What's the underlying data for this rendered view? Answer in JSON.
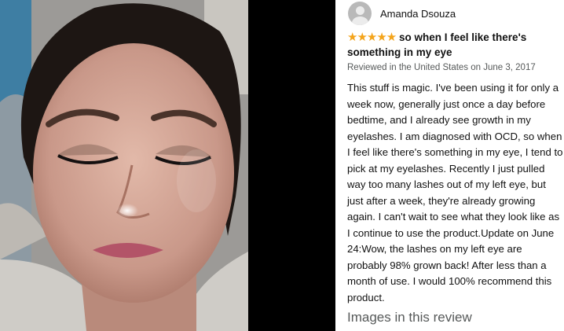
{
  "reviewer": {
    "name": "Amanda Dsouza",
    "avatar_icon": "default-user-avatar-icon"
  },
  "rating": {
    "stars": 5,
    "max": 5,
    "display": "★★★★★"
  },
  "review": {
    "title": "so when I feel like there's something in my eye",
    "meta": "Reviewed in the United States on June 3, 2017",
    "body": "This stuff is magic. I've been using it for only a week now, generally just once a day before bedtime, and I already see growth in my eyelashes. I am diagnosed with OCD, so when I feel like there's something in my eye, I tend to pick at my eyelashes. Recently I just pulled way too many lashes out of my left eye, but just after a week, they're already growing again. I can't wait to see what they look like as I continue to use the product.Update on June 24:Wow, the lashes on my left eye are probably 98% grown back! After less than a month of use. I would 100% recommend this product."
  },
  "images_section": {
    "heading": "Images in this review"
  },
  "colors": {
    "star": "#f4a41b",
    "meta_text": "#565959",
    "panel_bg": "#ffffff",
    "backdrop": "#000000"
  }
}
